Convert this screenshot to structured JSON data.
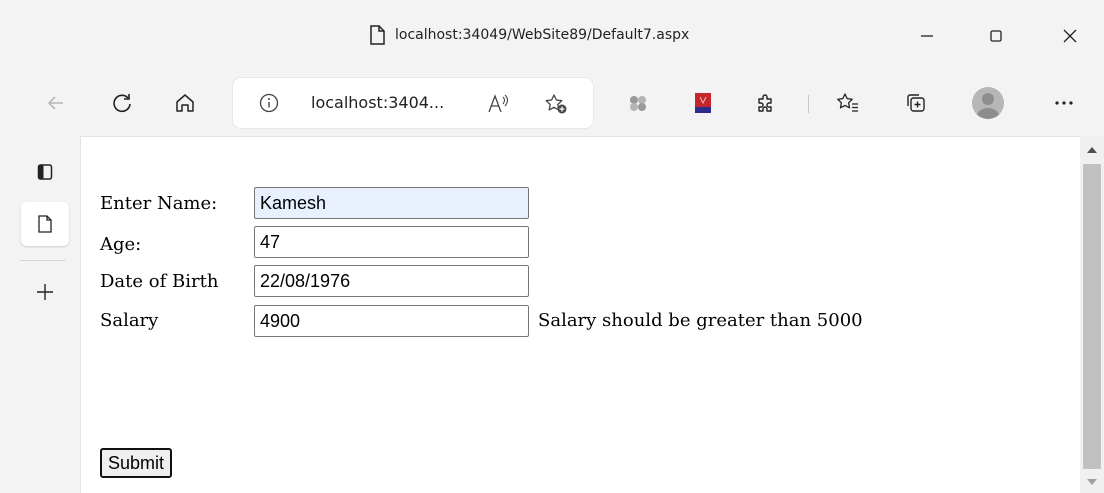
{
  "window": {
    "title": "localhost:34049/WebSite89/Default7.aspx",
    "controls": [
      "minimize-icon",
      "maximize-icon",
      "close-icon"
    ]
  },
  "toolbar": {
    "address_text": "localhost:3404...",
    "icons": [
      "back-icon",
      "refresh-icon",
      "home-icon",
      "info-icon",
      "read-aloud-icon",
      "add-favorite-icon",
      "extension-icon",
      "pdf-extension-icon",
      "extensions-icon",
      "favorites-icon",
      "collections-icon",
      "profile-avatar",
      "more-icon"
    ]
  },
  "sidebar": {
    "icons": [
      "sidebar-tabs-icon",
      "page-icon",
      "add-icon"
    ]
  },
  "form": {
    "name_label": "Enter Name:",
    "name_value": "Kamesh",
    "age_label": "Age:",
    "age_value": "47",
    "dob_label": "Date of Birth",
    "dob_value": "22/08/1976",
    "salary_label": "Salary",
    "salary_value": "4900",
    "salary_error": "Salary should be greater than 5000",
    "submit_label": "Submit"
  },
  "colors": {
    "chrome_bg": "#f3f3f3",
    "autofill_bg": "#e8f0fe",
    "scroll_thumb": "#c1c1c1"
  }
}
